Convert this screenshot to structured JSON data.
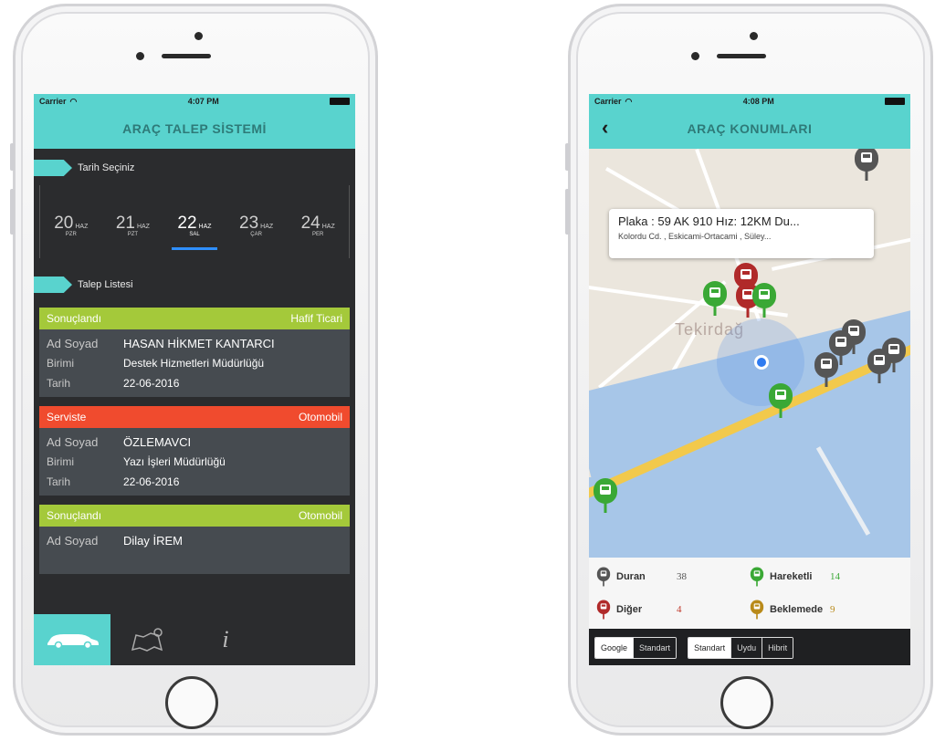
{
  "left": {
    "status": {
      "carrier": "Carrier",
      "time": "4:07 PM"
    },
    "title": "ARAÇ TALEP SİSTEMİ",
    "date_section": "Tarih Seçiniz",
    "dates": [
      {
        "num": "20",
        "mon": "HAZ",
        "day": "PZR"
      },
      {
        "num": "21",
        "mon": "HAZ",
        "day": "PZT"
      },
      {
        "num": "22",
        "mon": "HAZ",
        "day": "SAL"
      },
      {
        "num": "23",
        "mon": "HAZ",
        "day": "ÇAR"
      },
      {
        "num": "24",
        "mon": "HAZ",
        "day": "PER"
      }
    ],
    "list_section": "Talep Listesi",
    "requests": [
      {
        "status": "Sonuçlandı",
        "type": "Hafif Ticari",
        "color": "#a4c93a",
        "name_label": "Ad Soyad",
        "name": "HASAN HİKMET KANTARCI",
        "unit_label": "Birimi",
        "unit": "Destek Hizmetleri Müdürlüğü",
        "date_label": "Tarih",
        "date": "22-06-2016"
      },
      {
        "status": "Serviste",
        "type": "Otomobil",
        "color": "#f04b2e",
        "name_label": "Ad Soyad",
        "name": "ÖZLEMAVCI",
        "unit_label": "Birimi",
        "unit": "Yazı İşleri Müdürlüğü",
        "date_label": "Tarih",
        "date": "22-06-2016"
      },
      {
        "status": "Sonuçlandı",
        "type": "Otomobil",
        "color": "#a4c93a",
        "name_label": "Ad Soyad",
        "name": "Dilay İREM"
      }
    ],
    "tabs": [
      {
        "icon": "car-icon"
      },
      {
        "icon": "map-pin-icon"
      },
      {
        "icon": "info-icon",
        "label": "i"
      }
    ]
  },
  "right": {
    "status": {
      "carrier": "Carrier",
      "time": "4:08 PM"
    },
    "title": "ARAÇ KONUMLARI",
    "bubble": {
      "line1": "Plaka : 59 AK 910 Hız: 12KM Du...",
      "line2": "Kolordu Cd. , Eskicami-Ortacami , Süley..."
    },
    "town_label": "Tekirdağ",
    "legend": [
      {
        "label": "Duran",
        "count": "38",
        "color": "#555555",
        "count_color": "#555555"
      },
      {
        "label": "Hareketli",
        "count": "14",
        "color": "#3aa835",
        "count_color": "#3aa835"
      },
      {
        "label": "Diğer",
        "count": "4",
        "color": "#b02a2a",
        "count_color": "#c0392b"
      },
      {
        "label": "Beklemede",
        "count": "9",
        "color": "#b98a1a",
        "count_color": "#b98a1a"
      }
    ],
    "map_source": {
      "options": [
        "Google",
        "Standart"
      ],
      "selected": "Google"
    },
    "map_type": {
      "options": [
        "Standart",
        "Uydu",
        "Hibrit"
      ],
      "selected": "Standart"
    }
  }
}
